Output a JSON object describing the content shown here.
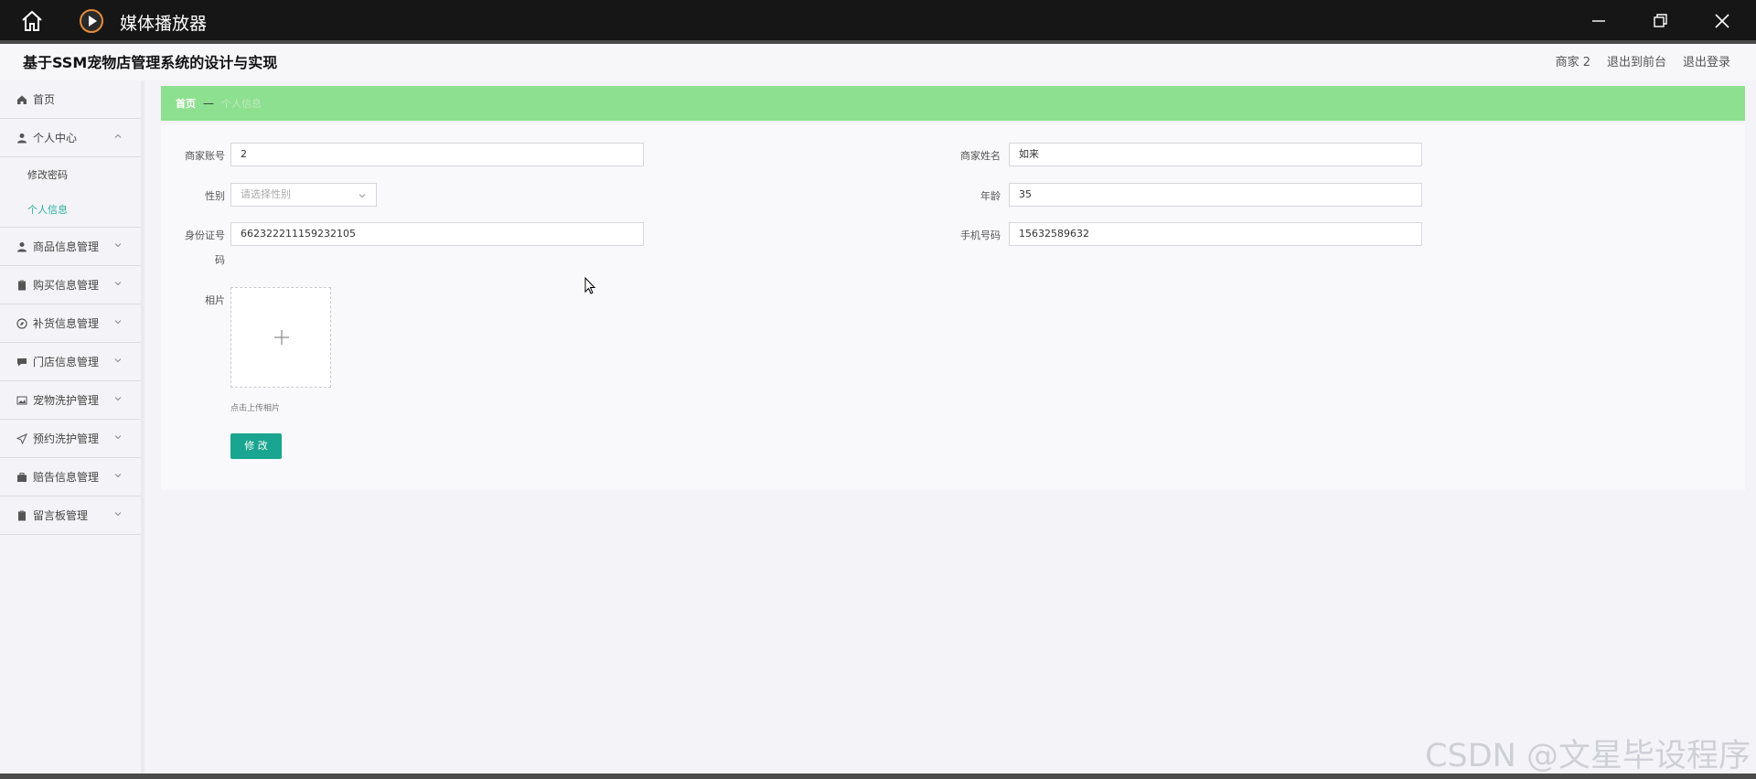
{
  "window": {
    "title": "媒体播放器",
    "home_icon": "home-icon",
    "app_icon": "play-icon"
  },
  "header": {
    "system_title": "基于SSM宠物店管理系统的设计与实现",
    "user": "商家 2",
    "to_frontend": "退出到前台",
    "logout": "退出登录"
  },
  "sidebar": {
    "items": [
      {
        "label": "首页",
        "icon": "home-icon"
      },
      {
        "label": "个人中心",
        "icon": "user-icon",
        "expanded": true,
        "children": [
          {
            "label": "修改密码"
          },
          {
            "label": "个人信息",
            "active": true
          }
        ]
      },
      {
        "label": "商品信息管理",
        "icon": "user-icon"
      },
      {
        "label": "购买信息管理",
        "icon": "clipboard-icon"
      },
      {
        "label": "补货信息管理",
        "icon": "compass-icon"
      },
      {
        "label": "门店信息管理",
        "icon": "chat-icon"
      },
      {
        "label": "宠物洗护管理",
        "icon": "picture-icon"
      },
      {
        "label": "预约洗护管理",
        "icon": "send-icon"
      },
      {
        "label": "赔告信息管理",
        "icon": "briefcase-icon"
      },
      {
        "label": "留言板管理",
        "icon": "clipboard-icon"
      }
    ]
  },
  "breadcrumb": {
    "home": "首页",
    "separator": "—",
    "current": "个人信息"
  },
  "form": {
    "account_label": "商家账号",
    "account_value": "2",
    "name_label": "商家姓名",
    "name_value": "如来",
    "gender_label": "性别",
    "gender_placeholder": "请选择性别",
    "age_label": "年龄",
    "age_value": "35",
    "idcard_label": "身份证号",
    "idcard_label_2": "码",
    "idcard_value": "662322211159232105",
    "phone_label": "手机号码",
    "phone_value": "15632589632",
    "photo_label": "相片",
    "upload_tip": "点击上传相片",
    "submit": "修 改"
  },
  "watermark": "CSDN @文星毕设程序",
  "colors": {
    "titlebar": "#161616",
    "breadcrumb_bg": "#8de08f",
    "accent": "#2bb0a0",
    "button": "#19a58f"
  }
}
